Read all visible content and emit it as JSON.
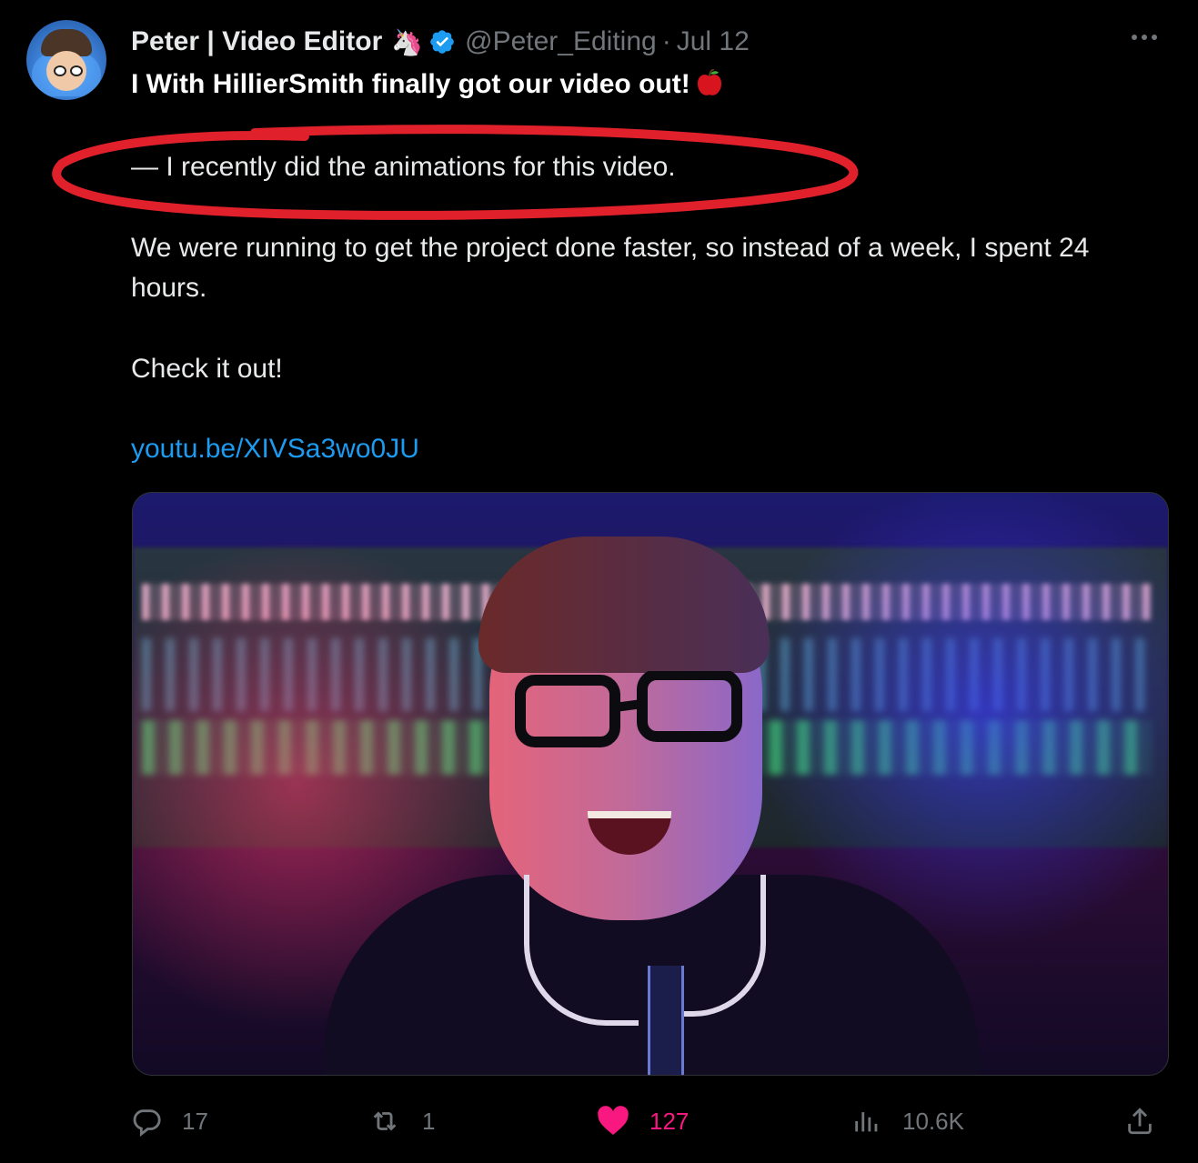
{
  "author": {
    "name": "Peter | Video Editor",
    "handle": "@Peter_Editing",
    "date": "Jul 12",
    "separator": "·"
  },
  "tweet": {
    "line1": "I With HillierSmith finally got our video out!",
    "line2": "— I recently did the animations for this video.",
    "line3": "We were running to get the project done faster, so instead of a week, I spent 24 hours.",
    "line4": "Check it out!",
    "link": "youtu.be/XIVSa3wo0JU"
  },
  "actions": {
    "replies": "17",
    "retweets": "1",
    "likes": "127",
    "views": "10.6K"
  },
  "colors": {
    "link": "#1d9bf0",
    "like": "#f91880",
    "annotation": "#e0202a",
    "verified": "#1d9bf0"
  },
  "icons": [
    "more-icon",
    "verified-icon",
    "unicorn-emoji",
    "apple-emoji",
    "reply-icon",
    "retweet-icon",
    "like-icon",
    "views-icon",
    "share-icon"
  ]
}
